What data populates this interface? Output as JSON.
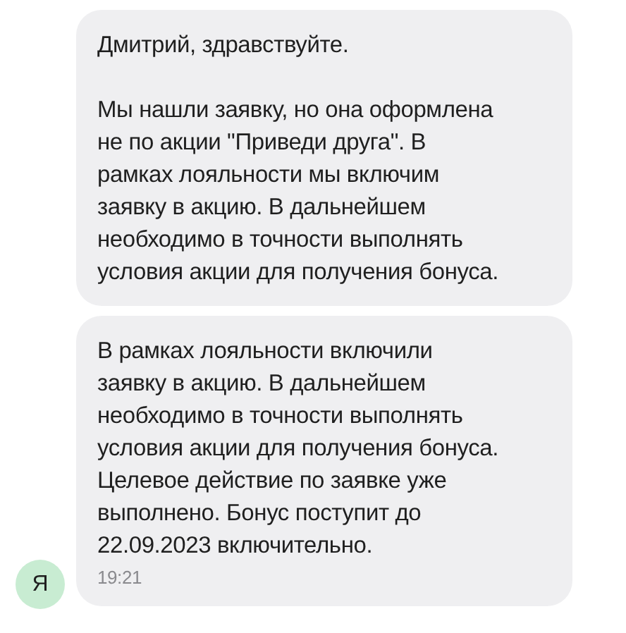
{
  "messages": [
    {
      "paragraphs": [
        "Дмитрий, здравствуйте.",
        "Мы нашли заявку, но она оформлена\nне по акции \"Приведи друга\". В\nрамках лояльности мы включим\nзаявку в акцию. В дальнейшем\nнеобходимо в точности выполнять\nусловия акции для получения бонуса."
      ]
    },
    {
      "paragraphs": [
        "В рамках лояльности включили\nзаявку в акцию. В дальнейшем\nнеобходимо в точности выполнять\nусловия акции для получения бонуса.\nЦелевое действие по заявке уже\nвыполнено. Бонус поступит до\n22.09.2023 включительно."
      ],
      "time": "19:21",
      "avatar": "Я"
    }
  ]
}
